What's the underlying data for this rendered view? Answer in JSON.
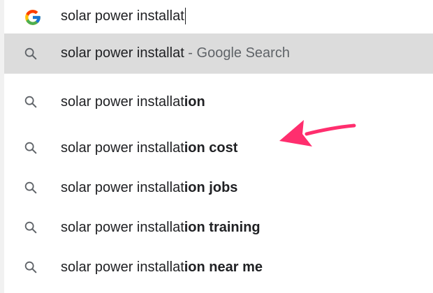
{
  "omnibox": {
    "query": "solar power installat",
    "logo_icon": "google-g-icon"
  },
  "suggestions": [
    {
      "prefix": "solar power installat",
      "sep": " - ",
      "hint": "Google Search",
      "icon": "search-icon",
      "selected": true
    },
    {
      "prefix": "solar power installat",
      "completion": "ion",
      "icon": "search-icon"
    },
    {
      "prefix": "solar power installat",
      "completion": "ion cost",
      "icon": "search-icon"
    },
    {
      "prefix": "solar power installat",
      "completion": "ion jobs",
      "icon": "search-icon"
    },
    {
      "prefix": "solar power installat",
      "completion": "ion training",
      "icon": "search-icon"
    },
    {
      "prefix": "solar power installat",
      "completion": "ion near me",
      "icon": "search-icon"
    }
  ],
  "colors": {
    "selected_bg": "#dcdcdc",
    "arrow": "#ff2e6e",
    "text": "#202124",
    "hint_text": "#5f6368"
  }
}
